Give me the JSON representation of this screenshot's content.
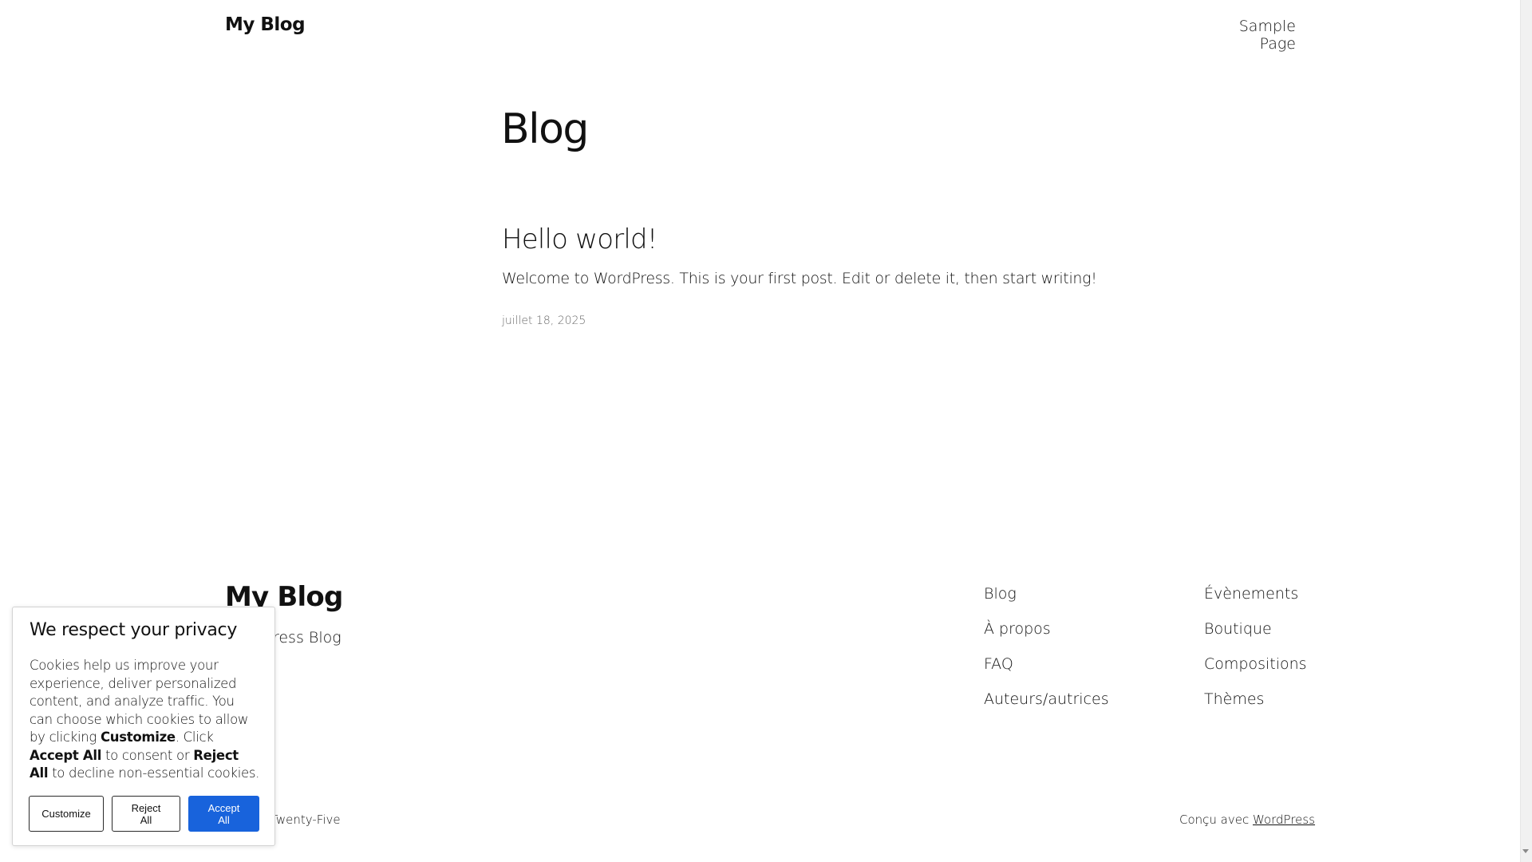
{
  "header": {
    "site_title": "My Blog",
    "nav": [
      "Sample Page"
    ]
  },
  "main": {
    "page_title": "Blog",
    "post": {
      "title": "Hello world!",
      "excerpt": "Welcome to WordPress. This is your first post. Edit or delete it, then start writing!",
      "date": "juillet 18, 2025"
    }
  },
  "footer": {
    "site_title": "My Blog",
    "tagline": "WordPress Blog",
    "nav_col1": [
      "Blog",
      "À propos",
      "FAQ",
      "Auteurs/autrices"
    ],
    "nav_col2": [
      "Évènements",
      "Boutique",
      "Compositions",
      "Thèmes"
    ],
    "credit_left": "Twenty Twenty-Five",
    "credit_right_prefix": "Conçu avec ",
    "credit_right_link": "WordPress"
  },
  "cookie_banner": {
    "title": "We respect your privacy",
    "text_1": "Cookies help us improve your experience, deliver personalized content, and analyze traffic. You can choose which cookies to allow by clicking ",
    "bold_customize": "Customize",
    "text_2": ". Click ",
    "bold_accept": "Accept All",
    "text_3": " to consent or ",
    "bold_reject": "Reject All",
    "text_4": " to decline non-essential cookies.",
    "buttons": {
      "customize": "Customize",
      "reject": "Reject All",
      "accept": "Accept All"
    },
    "accent_color": "#1863dc"
  }
}
